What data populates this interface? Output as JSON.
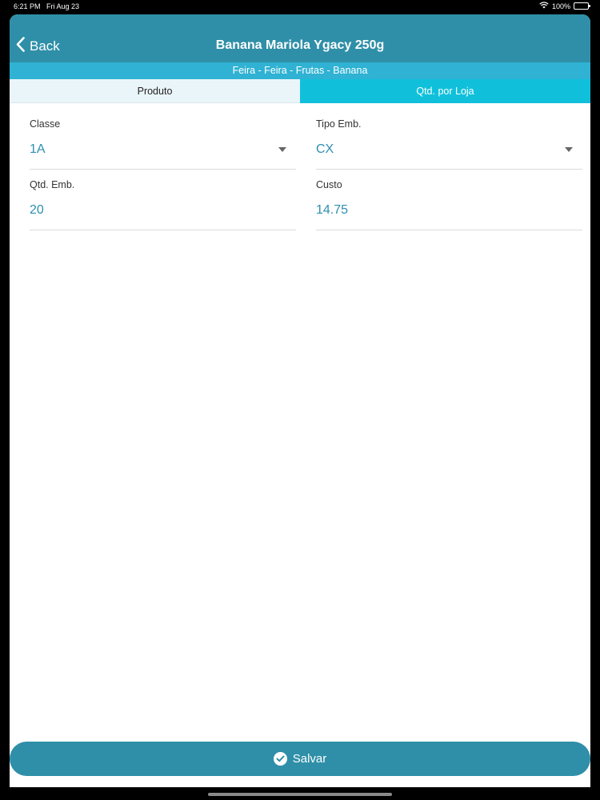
{
  "status_bar": {
    "time": "6:21 PM",
    "date": "Fri Aug 23",
    "battery_percent": "100%",
    "battery_level": 1.0
  },
  "header": {
    "back_label": "Back",
    "title": "Banana Mariola Ygacy 250g",
    "breadcrumb": "Feira - Feira - Frutas - Banana"
  },
  "tabs": [
    {
      "label": "Produto",
      "active": true
    },
    {
      "label": "Qtd. por Loja",
      "active": false
    }
  ],
  "form": {
    "classe": {
      "label": "Classe",
      "value": "1A"
    },
    "tipo_emb": {
      "label": "Tipo Emb.",
      "value": "CX"
    },
    "qtd_emb": {
      "label": "Qtd. Emb.",
      "value": "20"
    },
    "custo": {
      "label": "Custo",
      "value": "14.75"
    }
  },
  "save_button": {
    "label": "Salvar"
  },
  "colors": {
    "header": "#2f8fa8",
    "breadcrumb_bar": "#2fb2d3",
    "active_tab": "#eaf5f9",
    "inactive_tab": "#10c0db",
    "value_text": "#2e8fb0"
  },
  "icons": {
    "back": "chevron-left-icon",
    "wifi": "wifi-icon",
    "battery": "battery-icon",
    "dropdown": "caret-down-icon",
    "save": "check-circle-icon"
  }
}
